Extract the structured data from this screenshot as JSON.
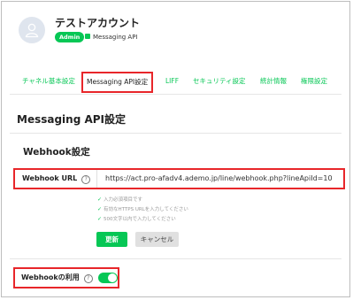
{
  "header": {
    "account_name": "テストアカウント",
    "role_badge": "Admin",
    "plan_label": "Messaging API"
  },
  "tabs": [
    {
      "label": "チャネル基本設定"
    },
    {
      "label": "Messaging API設定",
      "active": true
    },
    {
      "label": "LIFF"
    },
    {
      "label": "セキュリティ設定"
    },
    {
      "label": "統計情報"
    },
    {
      "label": "権限設定"
    }
  ],
  "main": {
    "section_title": "Messaging API設定",
    "webhook_title": "Webhook設定",
    "webhook_url": {
      "label": "Webhook URL",
      "help": "?",
      "value": "https://act.pro-afadv4.ademo.jp/line/webhook.php?lineApiId=10"
    },
    "hints": [
      "入力必須項目です",
      "有効なHTTPS URLを入力してください",
      "500文字以内で入力してください"
    ],
    "update_button": "更新",
    "cancel_button": "キャンセル",
    "webhook_use": {
      "label": "Webhookの利用",
      "help": "?",
      "enabled": true
    }
  },
  "colors": {
    "accent": "#06c755",
    "highlight": "#e8262a"
  }
}
